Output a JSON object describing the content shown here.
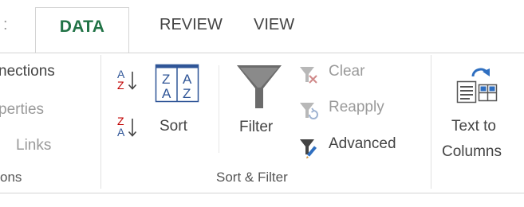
{
  "tabs": {
    "left_partial": ":",
    "data": "DATA",
    "review": "REVIEW",
    "view": "VIEW"
  },
  "connections_group": {
    "connections": "nections",
    "properties": "perties",
    "edit_links": "Links",
    "label": "ons"
  },
  "sort_filter_group": {
    "sort": "Sort",
    "filter": "Filter",
    "clear": "Clear",
    "reapply": "Reapply",
    "advanced": "Advanced",
    "label": "Sort & Filter",
    "sort_az_icon_glyph": {
      "top": "A",
      "bottom": "Z"
    },
    "sort_za_icon_glyph": {
      "top": "Z",
      "bottom": "A"
    },
    "sort_dialog_glyph": {
      "a": "Z",
      "b": "A",
      "c": "A",
      "d": "Z"
    }
  },
  "data_tools_group": {
    "text_to_columns_line1": "Text to",
    "text_to_columns_line2": "Columns"
  },
  "colors": {
    "accent_green": "#217346",
    "sort_blue": "#2f5597",
    "sort_red": "#c00000",
    "text": "#444444",
    "disabled": "#9a9a9a",
    "border": "#d4d4d4"
  }
}
